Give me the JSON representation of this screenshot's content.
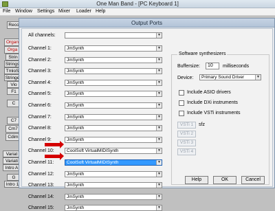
{
  "window": {
    "title": "One Man Band - [PC Keyboard 1]",
    "menu": [
      "File",
      "Window",
      "Settings",
      "Mixer",
      "Loader",
      "Help"
    ]
  },
  "background_panel": {
    "items": [
      "Reco",
      "Organ",
      "Orga",
      "Strin",
      "Strings",
      "TmloS",
      "Stringe",
      "Vio",
      "F1",
      "C",
      "C7",
      "Cm7",
      "Cdim",
      "Variat",
      "Variati",
      "Intro A",
      "G",
      "Intro 1"
    ]
  },
  "dialog": {
    "title": "Output Ports",
    "all_channels_label": "All channels:",
    "all_channels_value": "",
    "channels": [
      {
        "label": "Channel 1:",
        "value": "JmSynth"
      },
      {
        "label": "Channel 2:",
        "value": "JmSynth"
      },
      {
        "label": "Channel 3:",
        "value": "JmSynth"
      },
      {
        "label": "Channel 4:",
        "value": "JmSynth"
      },
      {
        "label": "Channel 5:",
        "value": "JmSynth"
      },
      {
        "label": "Channel 6:",
        "value": "JmSynth"
      },
      {
        "label": "Channel 7:",
        "value": "JmSynth"
      },
      {
        "label": "Channel 8:",
        "value": "JmSynth"
      },
      {
        "label": "Channel 9:",
        "value": "JmSynth"
      },
      {
        "label": "Channel 10:",
        "value": "CoolSoft VirtualMIDISynth"
      },
      {
        "label": "Channel 11:",
        "value": "CoolSoft VirtualMIDISynth"
      },
      {
        "label": "Channel 12:",
        "value": "JmSynth"
      },
      {
        "label": "Channel 13:",
        "value": "JmSynth"
      },
      {
        "label": "Channel 14:",
        "value": "JmSynth"
      },
      {
        "label": "Channel 15:",
        "value": "JmSynth"
      }
    ],
    "software_synth": {
      "group_title": "Software synthesizers",
      "buffersize_label": "Buffersize:",
      "buffersize_value": "10",
      "buffersize_unit": "milliseconds",
      "device_label": "Device:",
      "device_value": "Primary Sound Driver",
      "include_asio": "Include ASIO drivers",
      "include_dxi": "Include DXi instruments",
      "include_vsti": "Include VSTi instruments",
      "vsti_buttons": [
        "VSTi 1",
        "VSTi 2",
        "VSTi 3",
        "VSTi 4"
      ],
      "sfz_label": "sfz"
    },
    "buttons": {
      "help": "Help",
      "ok": "OK",
      "cancel": "Cancel"
    }
  },
  "colors": {
    "arrow": "#d40000",
    "selection": "#3399ff"
  }
}
